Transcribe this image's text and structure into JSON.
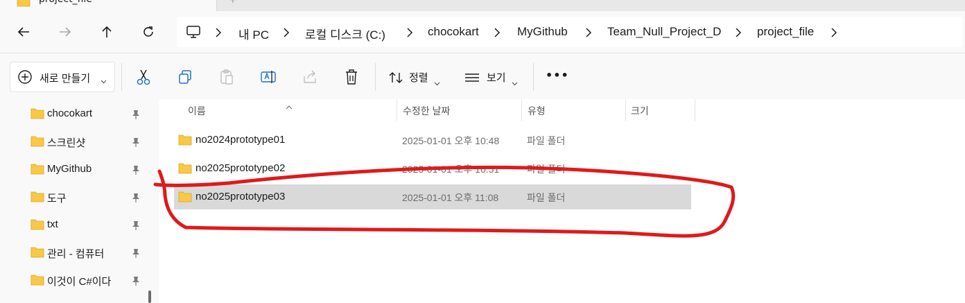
{
  "window": {
    "tab_title": "project_file",
    "new_tab_symbol": "+"
  },
  "nav": {
    "back_icon": "arrow-left-icon",
    "forward_icon": "arrow-right-icon",
    "up_icon": "arrow-up-icon",
    "refresh_icon": "refresh-icon"
  },
  "breadcrumb": {
    "root_icon": "computer-icon",
    "items": [
      "내 PC",
      "로컬 디스크 (C:)",
      "chocokart",
      "MyGithub",
      "Team_Null_Project_D",
      "project_file"
    ]
  },
  "toolbar": {
    "new_label": "새로 만들기",
    "sort_label": "정렬",
    "view_label": "보기",
    "more_label": "•••",
    "tools": [
      "cut-icon",
      "copy-icon",
      "paste-icon",
      "rename-icon",
      "share-icon",
      "delete-icon"
    ]
  },
  "sidebar": {
    "items": [
      {
        "label": "chocokart",
        "pinned": true
      },
      {
        "label": "스크린샷",
        "pinned": true
      },
      {
        "label": "MyGithub",
        "pinned": true
      },
      {
        "label": "도구",
        "pinned": true
      },
      {
        "label": "txt",
        "pinned": true
      },
      {
        "label": "관리 - 컴퓨터",
        "pinned": true
      },
      {
        "label": "이것이 C#이다",
        "pinned": true
      }
    ]
  },
  "columns": {
    "name": "이름",
    "date": "수정한 날짜",
    "type": "유형",
    "size": "크기"
  },
  "files": [
    {
      "name": "no2024prototype01",
      "date": "2025-01-01 오후 10:48",
      "type": "파일 폴더",
      "selected": false
    },
    {
      "name": "no2025prototype02",
      "date": "2025-01-01 오후 10:51",
      "type": "파일 폴더",
      "selected": false
    },
    {
      "name": "no2025prototype03",
      "date": "2025-01-01 오후 11:08",
      "type": "파일 폴더",
      "selected": true
    }
  ],
  "colors": {
    "folder": "#f8c846",
    "annotation": "#e0191b",
    "selection": "#d9d9d9",
    "accent": "#1a73c7"
  }
}
